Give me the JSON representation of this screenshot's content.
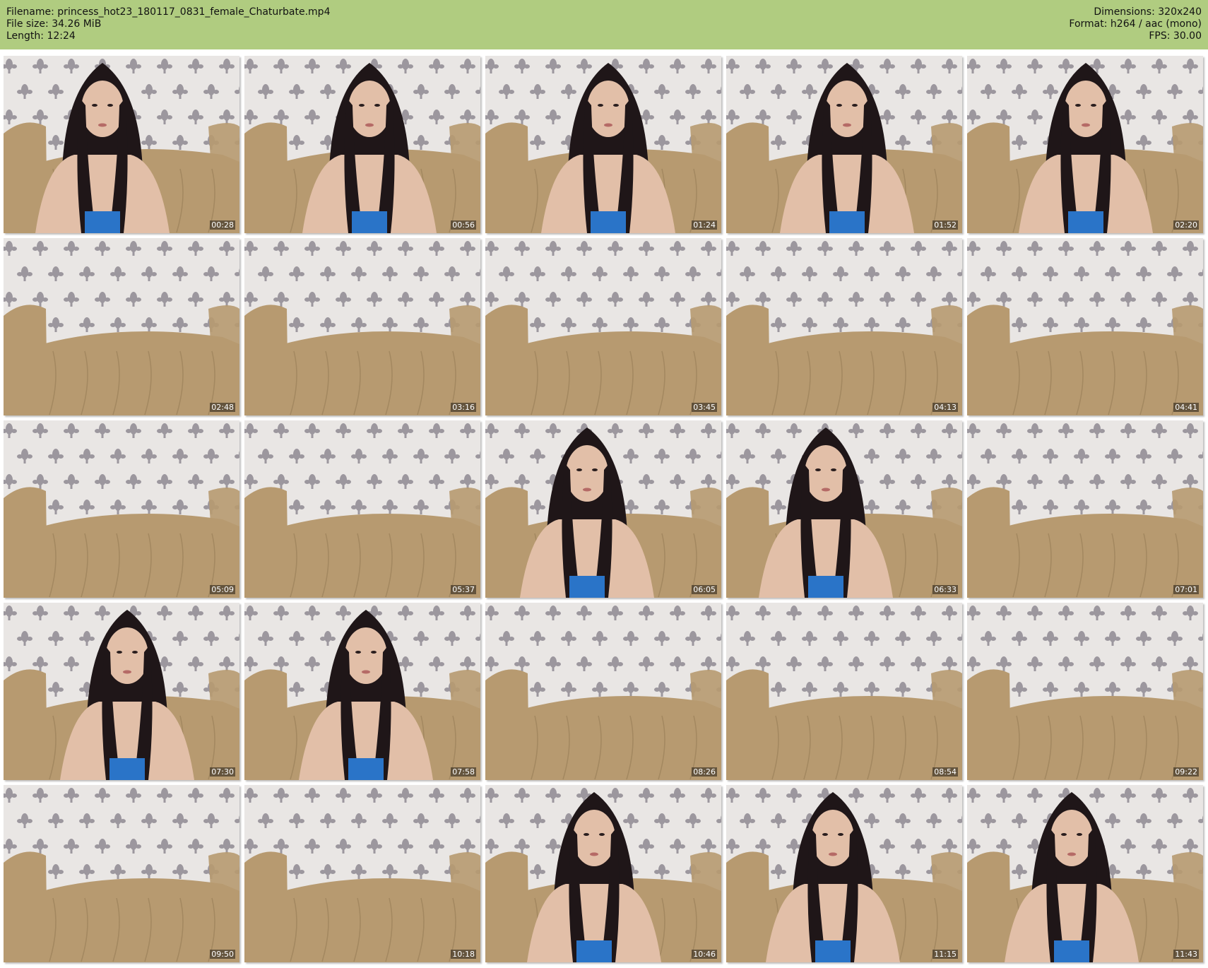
{
  "header": {
    "filename_label": "Filename: princess_hot23_180117_0831_female_Chaturbate.mp4",
    "filesize_label": "File size: 34.26 MiB",
    "length_label": "Length: 12:24",
    "dimensions_label": "Dimensions: 320x240",
    "format_label": "Format: h264 / aac (mono)",
    "fps_label": "FPS: 30.00"
  },
  "colors": {
    "header_bg": "#b0cc80",
    "wallpaper": "#e9e6e4",
    "damask": "#8f8a92",
    "sofa": "#b79a70",
    "hair": "#1f1618",
    "skin": "#e2bfa8",
    "top_blue": "#2a74c8"
  },
  "thumbnails": [
    {
      "time": "00:28",
      "scene": "person"
    },
    {
      "time": "00:56",
      "scene": "person"
    },
    {
      "time": "01:24",
      "scene": "person"
    },
    {
      "time": "01:52",
      "scene": "person"
    },
    {
      "time": "02:20",
      "scene": "person"
    },
    {
      "time": "02:48",
      "scene": "empty"
    },
    {
      "time": "03:16",
      "scene": "empty"
    },
    {
      "time": "03:45",
      "scene": "empty"
    },
    {
      "time": "04:13",
      "scene": "empty"
    },
    {
      "time": "04:41",
      "scene": "empty"
    },
    {
      "time": "05:09",
      "scene": "empty"
    },
    {
      "time": "05:37",
      "scene": "empty"
    },
    {
      "time": "06:05",
      "scene": "person"
    },
    {
      "time": "06:33",
      "scene": "person"
    },
    {
      "time": "07:01",
      "scene": "empty"
    },
    {
      "time": "07:30",
      "scene": "person"
    },
    {
      "time": "07:58",
      "scene": "person"
    },
    {
      "time": "08:26",
      "scene": "empty"
    },
    {
      "time": "08:54",
      "scene": "empty"
    },
    {
      "time": "09:22",
      "scene": "empty"
    },
    {
      "time": "09:50",
      "scene": "empty"
    },
    {
      "time": "10:18",
      "scene": "empty"
    },
    {
      "time": "10:46",
      "scene": "person"
    },
    {
      "time": "11:15",
      "scene": "person"
    },
    {
      "time": "11:43",
      "scene": "person"
    }
  ]
}
